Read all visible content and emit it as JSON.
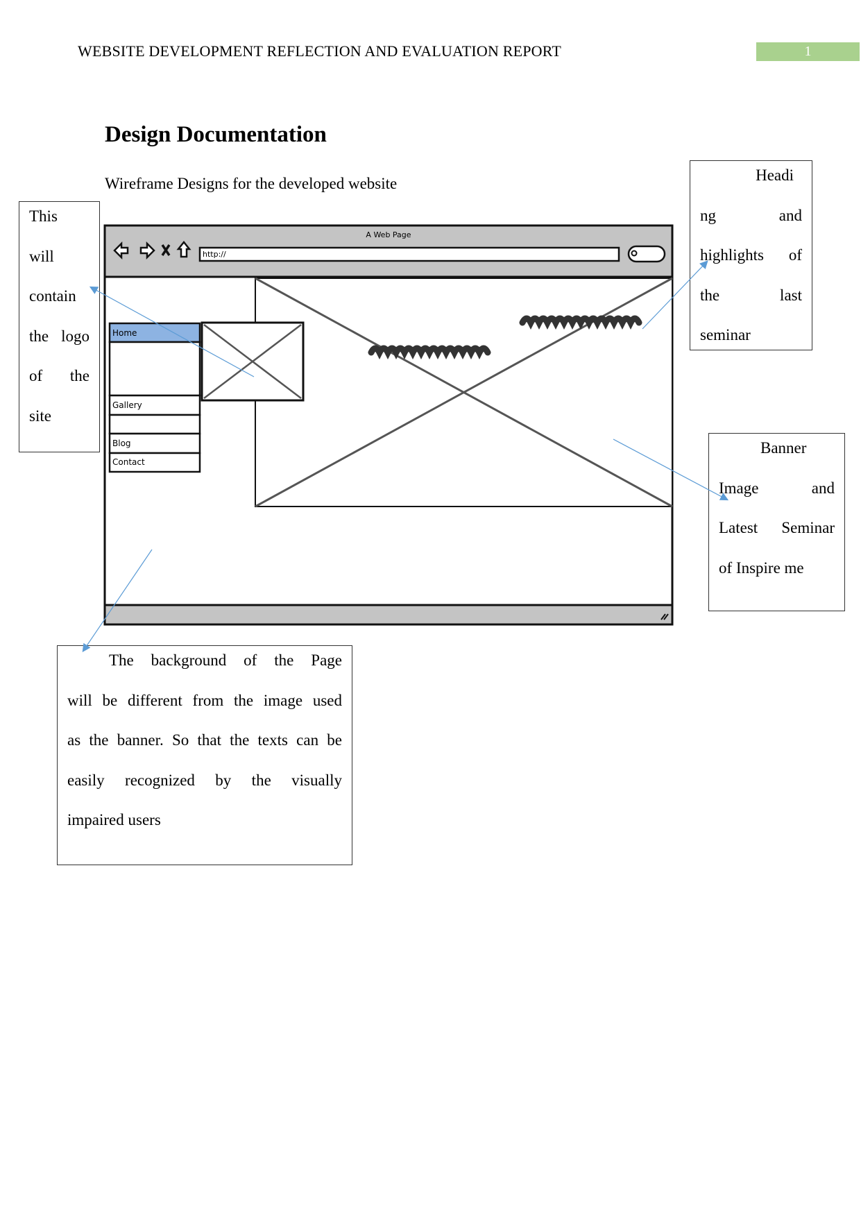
{
  "header": {
    "running_title": "WEBSITE DEVELOPMENT REFLECTION AND EVALUATION REPORT",
    "page_number": "1",
    "page_number_bg": "#a9d18e"
  },
  "section": {
    "title": "Design Documentation",
    "subtitle": "Wireframe Designs for the developed website"
  },
  "wireframe": {
    "window_title": "A Web Page",
    "url": "http://",
    "nav_items": [
      "Home",
      "Gallery",
      "Blog",
      "Contact"
    ],
    "active_nav": "Home",
    "active_color": "#8db3e2",
    "icons": [
      "back-arrow-icon",
      "forward-arrow-icon",
      "stop-icon",
      "home-icon",
      "search-icon",
      "resize-grip-icon"
    ]
  },
  "callouts": {
    "logo": {
      "lines": [
        "This",
        "will",
        "contain",
        "the  logo",
        "of    the",
        "site"
      ]
    },
    "heading": {
      "lines": [
        "Headi",
        "ng and",
        "highlights of",
        "the last",
        "seminar"
      ]
    },
    "banner": {
      "lines": [
        "Banner",
        "Image and",
        "Latest Seminar",
        "of Inspire me"
      ]
    },
    "background": {
      "lines": [
        "The background of the Page",
        "will be different from the image used",
        "as the banner.  So that the texts can be",
        "easily recognized by the visually",
        "impaired users"
      ]
    },
    "arrow_color": "#5b9bd5"
  }
}
